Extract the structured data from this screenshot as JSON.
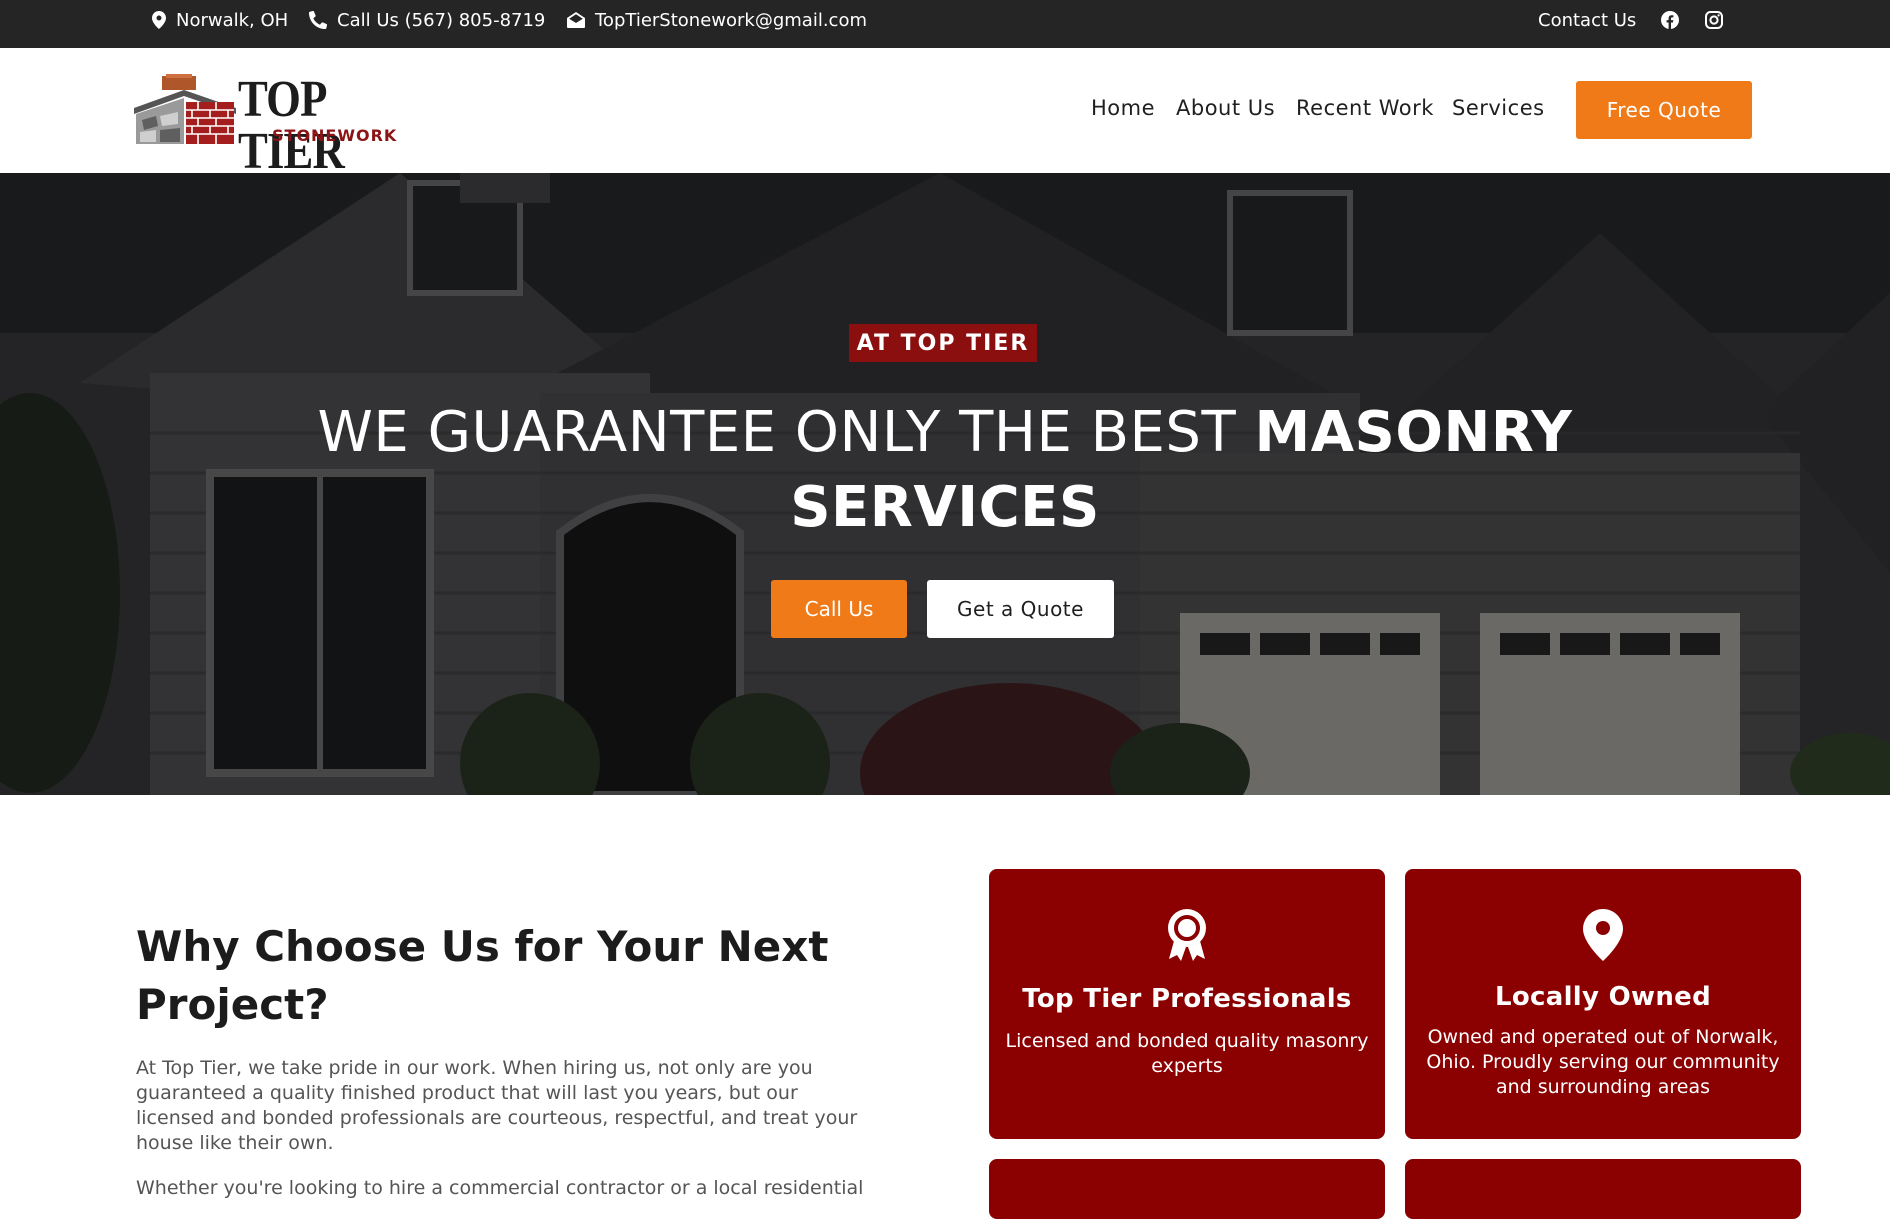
{
  "topbar": {
    "location": "Norwalk, OH",
    "phone": "Call Us (567) 805-8719",
    "email": "TopTierStonework@gmail.com",
    "contact_link": "Contact Us",
    "icons": [
      "map-pin-icon",
      "phone-icon",
      "envelope-icon",
      "facebook-icon",
      "instagram-icon"
    ]
  },
  "logo": {
    "title": "TOP TIER",
    "subtitle": "STONEWORK"
  },
  "nav": {
    "items": [
      "Home",
      "About Us",
      "Recent Work",
      "Services"
    ],
    "cta": "Free Quote"
  },
  "hero": {
    "badge": "AT TOP TIER",
    "title_regular": "WE GUARANTEE ONLY THE BEST ",
    "title_bold_1": "MASONRY",
    "title_bold_2": "SERVICES",
    "btn_call": "Call Us",
    "btn_quote": "Get a Quote"
  },
  "why": {
    "title": "Why Choose Us for Your Next Project?",
    "paragraph1": "At Top Tier, we take pride in our work. When hiring us, not only are you guaranteed a quality finished product that will last you years, but our licensed and bonded professionals are courteous, respectful, and treat your house like their own.",
    "paragraph2": "Whether you're looking to hire a commercial contractor or a local residential"
  },
  "cards": [
    {
      "icon": "award-ribbon-icon",
      "title": "Top Tier Professionals",
      "desc": "Licensed and bonded quality masonry experts"
    },
    {
      "icon": "map-pin-icon",
      "title": "Locally Owned",
      "desc": "Owned and operated out of Norwalk, Ohio. Proudly serving our community and surrounding areas"
    }
  ],
  "colors": {
    "accent_orange": "#ef7a17",
    "brand_red": "#8b0000",
    "topbar_bg": "#252525"
  }
}
